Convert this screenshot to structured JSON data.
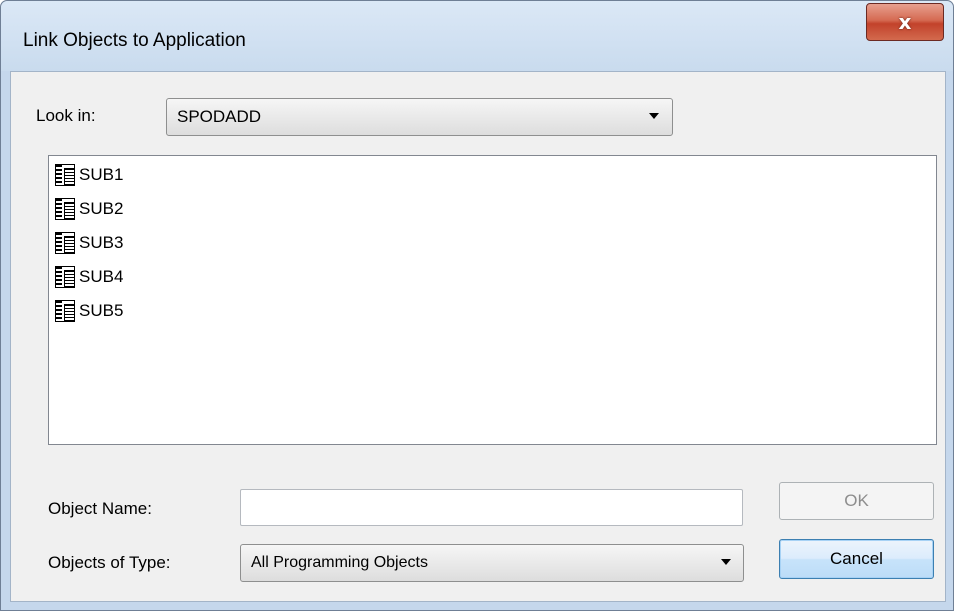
{
  "window": {
    "title": "Link Objects to Application",
    "close_glyph": "x"
  },
  "look_in": {
    "label": "Look in:",
    "value": "SPODADD"
  },
  "objects": [
    {
      "name": "SUB1",
      "icon": "program-object-icon"
    },
    {
      "name": "SUB2",
      "icon": "program-object-icon"
    },
    {
      "name": "SUB3",
      "icon": "program-object-icon"
    },
    {
      "name": "SUB4",
      "icon": "program-object-icon"
    },
    {
      "name": "SUB5",
      "icon": "program-object-icon"
    }
  ],
  "object_name": {
    "label": "Object Name:",
    "value": ""
  },
  "objects_of_type": {
    "label": "Objects of Type:",
    "value": "All Programming Objects"
  },
  "buttons": {
    "ok": "OK",
    "cancel": "Cancel"
  },
  "colors": {
    "close_button": "#c2422b",
    "default_button_border": "#3c7fb1",
    "dialog_background": "#f0f0f0"
  }
}
